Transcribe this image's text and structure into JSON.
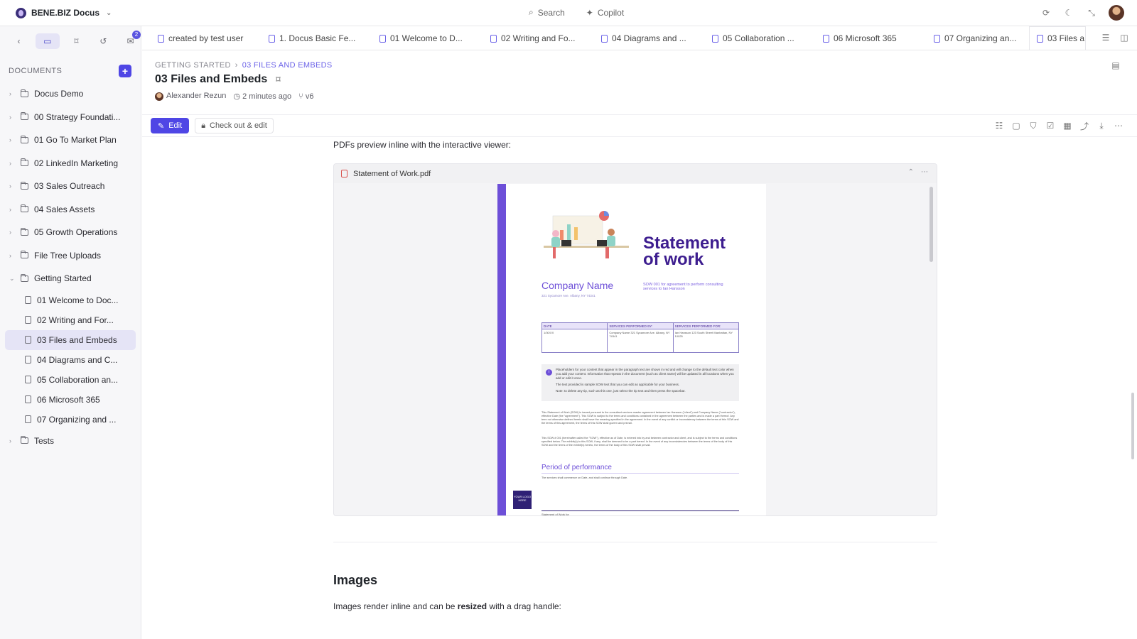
{
  "app": {
    "brand": "BENE.BIZ Docus"
  },
  "topbar": {
    "search_label": "Search",
    "copilot_label": "Copilot"
  },
  "sidebar": {
    "badge_count": "2",
    "docs_title": "DOCUMENTS",
    "folders": [
      "Docus Demo",
      "00 Strategy Foundati...",
      "01 Go To Market Plan",
      "02 LinkedIn Marketing",
      "03 Sales Outreach",
      "04 Sales Assets",
      "05 Growth Operations",
      "File Tree Uploads",
      "Getting Started"
    ],
    "children": [
      "01 Welcome to Doc...",
      "02 Writing and For...",
      "03 Files and Embeds",
      "04 Diagrams and C...",
      "05 Collaboration an...",
      "06 Microsoft 365",
      "07 Organizing and ..."
    ],
    "last_folder": "Tests"
  },
  "tabs": [
    "created by test user",
    "1. Docus Basic Fe...",
    "01 Welcome to D...",
    "02 Writing and Fo...",
    "04 Diagrams and ...",
    "05 Collaboration ...",
    "06 Microsoft 365",
    "07 Organizing an...",
    "03 Files a"
  ],
  "header": {
    "breadcrumb_root": "GETTING STARTED",
    "breadcrumb_current": "03 FILES AND EMBEDS",
    "title": "03 Files and Embeds",
    "author": "Alexander Rezun",
    "time": "2 minutes ago",
    "version": "v6"
  },
  "toolbar": {
    "edit_label": "Edit",
    "checkout_label": "Check out & edit"
  },
  "content": {
    "intro": "PDFs preview inline with the interactive viewer:",
    "pdf_filename": "Statement of Work.pdf",
    "section_title": "Images",
    "para_before": "Images render inline and can be ",
    "para_bold": "resized",
    "para_after": " with a drag handle:"
  },
  "pdf": {
    "title_line1": "Statement",
    "title_line2": "of work",
    "company": "Company Name",
    "subtitle": "SOW 001 for agreement to perform consulting services to Ian Hansson",
    "address": "321 Sycamore Ave. Albany, NY 74341",
    "table_headers": [
      "DATE",
      "SERVICES PERFORMED BY:",
      "SERVICES PERFORMED FOR:"
    ],
    "table_cells": [
      "1/30/XX",
      "Company Name 321 Sycamore Ave. Albany, NY 74341",
      "Ian Hansson 123 South Street Manhattan, NY 10025"
    ],
    "tip_1": "Placeholders for your content that appear in the paragraph text are shown in red and will change to the default text color when you add your content. Information that repeats in the document (such as client name) will be updated in all locations when you add or edit it once.",
    "tip_2": "The text provided is sample SOW text that you can edit as applicable for your business.",
    "tip_3": "Note: to delete any tip, such as this one, just select the tip text and then press the spacebar.",
    "body_1": "This Statement of Work (SOW) is issued pursuant to the consultant services master agreement between Ian Hansson (\"client\") and Company Name (\"contractor\"), effective Date (the \"agreement\"). This SOW is subject to the terms and conditions contained in the agreement between the parties and is made a part thereof. Any term not otherwise defined herein shall have the meaning specified in the agreement. In the event of any conflict or inconsistency between the terms of this SOW and the terms of this agreement, the terms of this SOW shall govern and prevail.",
    "body_2": "This SOW # 001 (hereinafter called the \"SOW\"), effective as of Date, is entered into by and between contractor and client, and is subject to the terms and conditions specified below. The exhibit(s) to this SOW, if any, shall be deemed to be a part hereof. In the event of any inconsistencies between the terms of the body of this SOW and the terms of the exhibit(s) hereto, the terms of the body of this SOW shall prevail.",
    "period_heading": "Period of performance",
    "period_text": "The services shall commence on Date, and shall continue through Date.",
    "logo_text": "YOUR LOGO HERE",
    "footer": "Statement of Work for"
  }
}
